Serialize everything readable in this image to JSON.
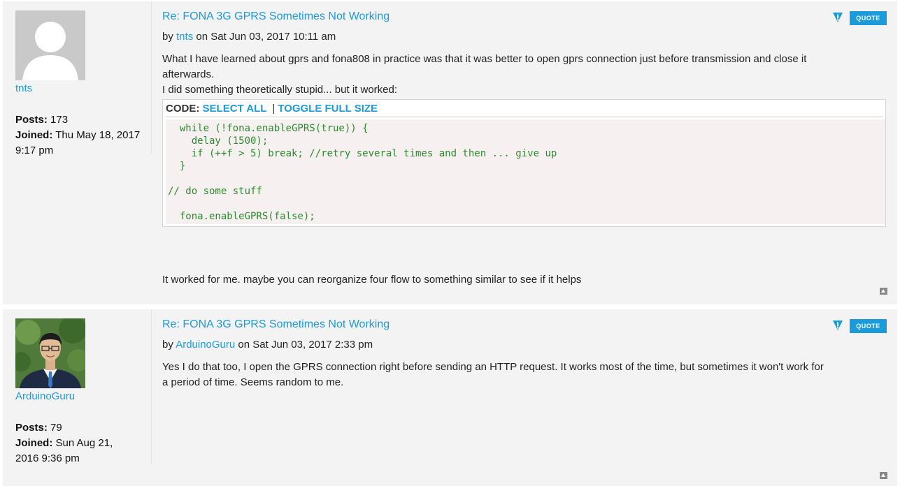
{
  "colors": {
    "link": "#1c9bdb",
    "code_text": "#2d8a2d",
    "code_bg": "#f7f0f0",
    "post_bg": "#f3f3f3"
  },
  "posts": [
    {
      "author": "tnts",
      "avatar": "default-avatar-icon",
      "posts_label": "Posts:",
      "posts_count": "173",
      "joined_label": "Joined:",
      "joined_line1": "Thu May 18, 2017",
      "joined_line2": "9:17 pm",
      "title": "Re: FONA 3G GPRS Sometimes Not Working",
      "by": "by",
      "date": "on Sat Jun 03, 2017 10:11 am",
      "quote_label": "QUOTE",
      "text_line1": "What I have learned about gprs and fona808 in practice was that it was better to open gprs connection just before transmission and close it",
      "text_line2": "afterwards.",
      "text_line3": "I did something theoretically stupid... but it worked:",
      "code_label": "CODE:",
      "select_all": "SELECT ALL",
      "separator": "|",
      "toggle_full": "TOGGLE FULL SIZE",
      "code_lines": [
        "  while (!fona.enableGPRS(true)) {",
        "    delay (1500);",
        "    if (++f > 5) break; //retry several times and then ... give up",
        "  }",
        "",
        "// do some stuff",
        "",
        "  fona.enableGPRS(false);"
      ],
      "after_code": "It worked for me. maybe you can reorganize four flow to something similar to see if it helps"
    },
    {
      "author": "ArduinoGuru",
      "avatar": "user-photo-avatar",
      "posts_label": "Posts:",
      "posts_count": "79",
      "joined_label": "Joined:",
      "joined_line1": "Sun Aug 21,",
      "joined_line2": "2016 9:36 pm",
      "title": "Re: FONA 3G GPRS Sometimes Not Working",
      "by": "by",
      "date": "on Sat Jun 03, 2017 2:33 pm",
      "quote_label": "QUOTE",
      "text_line1": "Yes I do that too, I open the GPRS connection right before sending an HTTP request. It works most of the time, but sometimes it won't work for",
      "text_line2": "a period of time. Seems random to me."
    }
  ]
}
